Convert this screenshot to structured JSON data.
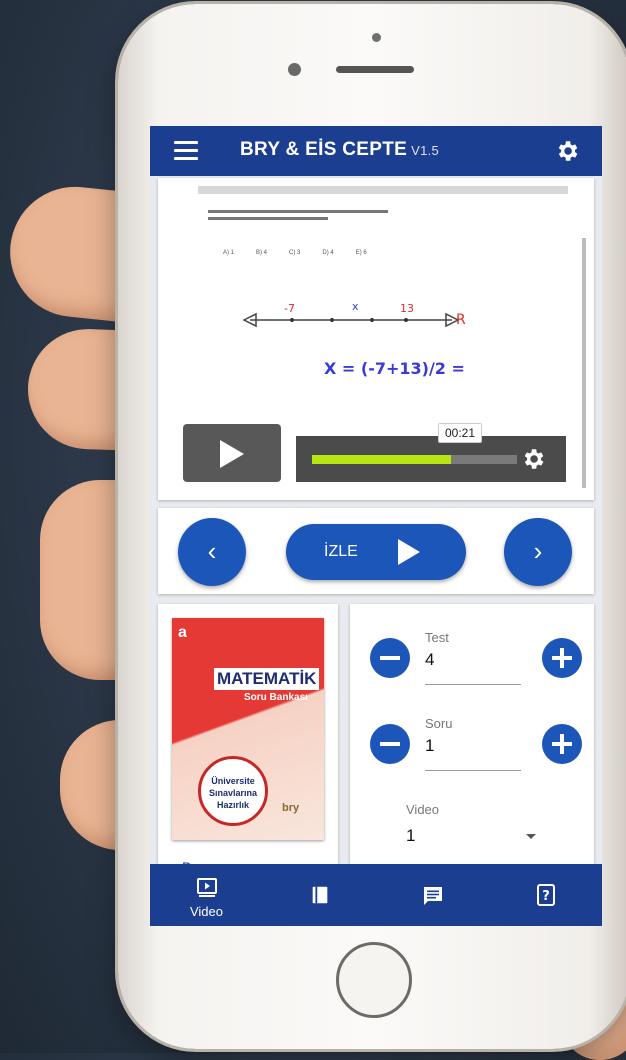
{
  "app": {
    "title": "BRY & EİS CEPTE",
    "version": "V1.5"
  },
  "video": {
    "time": "00:21",
    "progress_fraction": 0.68,
    "choices": [
      "A) 1",
      "B) 4",
      "C) 3",
      "D) 4",
      "E) 6"
    ],
    "board_text": "X = (-7+13)/2 =",
    "numberline_marks": [
      "-7",
      "x",
      "13"
    ]
  },
  "nav": {
    "prev_symbol": "‹",
    "next_symbol": "›",
    "watch_label": "İZLE"
  },
  "book": {
    "brand": "a",
    "title": "MATEMATİK",
    "subtitle": "Soru Bankası",
    "badge_lines": [
      "Üniversite",
      "Sınavlarına",
      "Hazırlık"
    ],
    "publisher": "bry",
    "caption": "Bry ..."
  },
  "fields": {
    "test": {
      "label": "Test",
      "value": "4"
    },
    "question": {
      "label": "Soru",
      "value": "1"
    },
    "video": {
      "label": "Video",
      "value": "1"
    }
  },
  "bottom_nav": {
    "video_label": "Video"
  },
  "colors": {
    "primary": "#1c3e90",
    "button": "#1b56b8",
    "progress": "#b8e613"
  }
}
